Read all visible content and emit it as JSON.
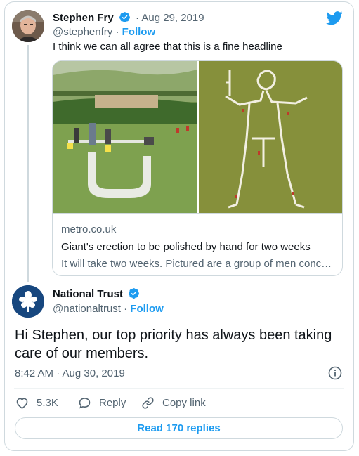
{
  "tweet1": {
    "name": "Stephen Fry",
    "date": "· Aug 29, 2019",
    "handle": "@stephenfry",
    "separator": " · ",
    "follow_label": "Follow",
    "text": "I think we can all agree that this is a fine headline",
    "link_card": {
      "domain": "metro.co.uk",
      "title": "Giant's erection to be polished by hand for two weeks",
      "description": "It will take two weeks. Pictured are a group of men conc…"
    }
  },
  "tweet2": {
    "name": "National Trust",
    "handle": "@nationaltrust",
    "separator": " · ",
    "follow_label": "Follow",
    "text": "Hi Stephen, our top priority has always been taking care of our members.",
    "timestamp": "8:42 AM · Aug 30, 2019",
    "actions": {
      "like_count": "5.3K",
      "reply_label": "Reply",
      "copy_label": "Copy link"
    },
    "read_replies_label": "Read 170 replies"
  },
  "icons": {
    "verified": "verified-badge-icon",
    "twitter": "twitter-bird-icon",
    "info": "info-icon",
    "like": "heart-icon",
    "reply": "speech-bubble-icon",
    "copy": "link-icon"
  },
  "colors": {
    "accent": "#1d9bf0",
    "text": "#0f1419",
    "secondary": "#536471",
    "border": "#cfd9de"
  }
}
